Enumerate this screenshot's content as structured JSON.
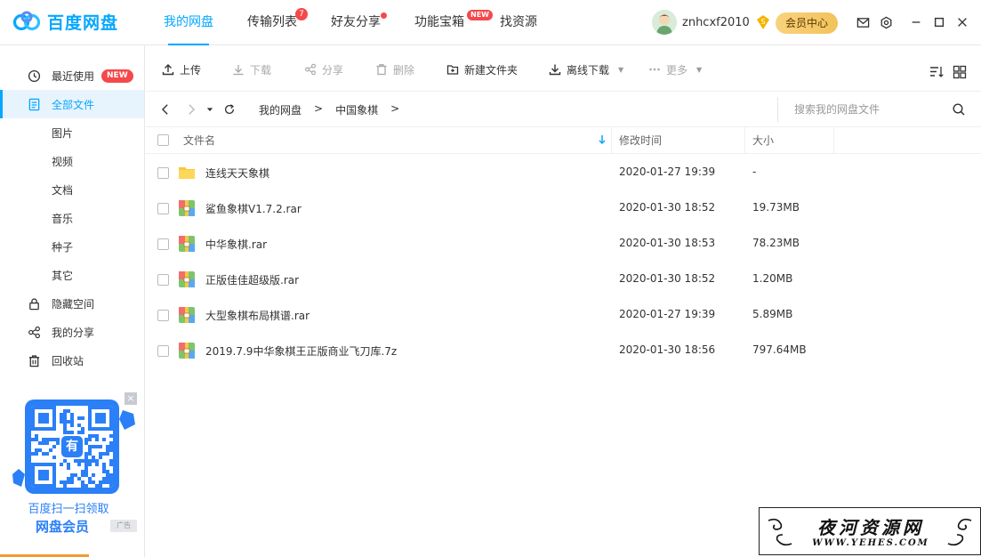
{
  "app": {
    "name": "百度网盘"
  },
  "nav": {
    "tabs": [
      {
        "label": "我的网盘",
        "active": true
      },
      {
        "label": "传输列表",
        "badge": "7"
      },
      {
        "label": "好友分享",
        "dot": true
      },
      {
        "label": "功能宝箱",
        "badge": "NEW"
      },
      {
        "label": "找资源"
      }
    ]
  },
  "user": {
    "name": "znhcxf2010",
    "vip_button": "会员中心"
  },
  "sidebar": {
    "items": [
      {
        "label": "最近使用",
        "icon": "clock-icon",
        "tag": "NEW"
      },
      {
        "label": "全部文件",
        "icon": "document-icon",
        "active": true
      },
      {
        "label": "图片",
        "sub": true
      },
      {
        "label": "视频",
        "sub": true
      },
      {
        "label": "文档",
        "sub": true
      },
      {
        "label": "音乐",
        "sub": true
      },
      {
        "label": "种子",
        "sub": true
      },
      {
        "label": "其它",
        "sub": true
      },
      {
        "label": "隐藏空间",
        "icon": "lock-icon"
      },
      {
        "label": "我的分享",
        "icon": "share-icon"
      },
      {
        "label": "回收站",
        "icon": "trash-icon"
      }
    ],
    "promo": {
      "qr_label": "有",
      "line1": "百度扫一扫领取",
      "line2": "网盘会员",
      "ad": "广告"
    }
  },
  "toolbar": {
    "upload": "上传",
    "download": "下载",
    "share": "分享",
    "delete": "删除",
    "new_folder": "新建文件夹",
    "offline_download": "离线下载",
    "more": "更多"
  },
  "path": {
    "crumbs": [
      "我的网盘",
      "中国象棋"
    ],
    "separator": ">",
    "search_placeholder": "搜索我的网盘文件"
  },
  "table": {
    "col_name": "文件名",
    "col_time": "修改时间",
    "col_size": "大小",
    "rows": [
      {
        "name": "连线天天象棋",
        "time": "2020-01-27 19:39",
        "size": "-",
        "type": "folder"
      },
      {
        "name": "鲨鱼象棋V1.7.2.rar",
        "time": "2020-01-30 18:52",
        "size": "19.73MB",
        "type": "archive"
      },
      {
        "name": "中华象棋.rar",
        "time": "2020-01-30 18:53",
        "size": "78.23MB",
        "type": "archive"
      },
      {
        "name": "正版佳佳超级版.rar",
        "time": "2020-01-30 18:52",
        "size": "1.20MB",
        "type": "archive"
      },
      {
        "name": "大型象棋布局棋谱.rar",
        "time": "2020-01-27 19:39",
        "size": "5.89MB",
        "type": "archive"
      },
      {
        "name": "2019.7.9中华象棋王正版商业飞刀库.7z",
        "time": "2020-01-30 18:56",
        "size": "797.64MB",
        "type": "archive"
      }
    ]
  },
  "watermark": {
    "title": "夜河资源网",
    "url": "WWW.YEHES.COM"
  },
  "colors": {
    "accent": "#06a7ff",
    "badge": "#f5484b",
    "vip": "#f2c35b"
  }
}
